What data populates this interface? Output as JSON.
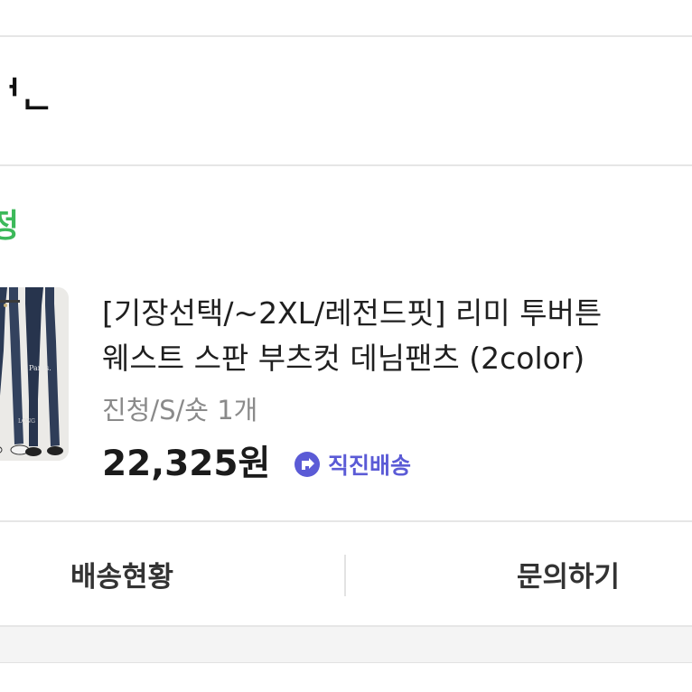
{
  "order": {
    "heading": "ᅥᆫ",
    "status": "정"
  },
  "product": {
    "thumbnail_icon": "jeans-product-photo",
    "thumbnail_text": [
      "Pants.",
      "LONG"
    ],
    "title": "[기장선택/~2XL/레전드핏] 리미 투버튼\n웨스트 스판 부츠컷 데님팬츠 (2color)",
    "option": "진청/S/숏 1개",
    "price": "22,325원",
    "shipping": {
      "icon": "direct-shipping-arrow-icon",
      "label": "직진배송",
      "color": "#5b5bd6"
    }
  },
  "actions": {
    "delivery_status": "배송현황",
    "inquiry": "문의하기"
  },
  "colors": {
    "status_green": "#3cb95a",
    "accent_purple": "#5b5bd6"
  }
}
